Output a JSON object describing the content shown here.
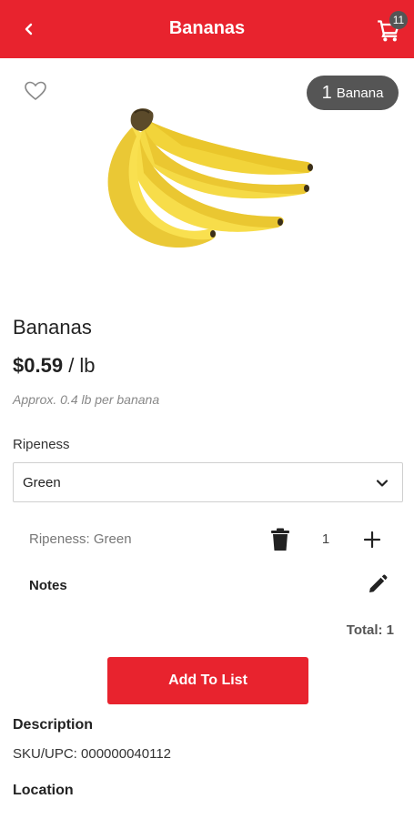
{
  "header": {
    "title": "Bananas",
    "back_icon": "chevron-left-icon",
    "cart_icon": "cart-icon",
    "cart_count": "11",
    "color": "#e8232e"
  },
  "product": {
    "favorite_icon": "heart-outline-icon",
    "unit_count": "1",
    "unit_word": "Banana",
    "image": "banana-bunch-image",
    "name": "Bananas",
    "price": "$0.59",
    "price_unit": "/ lb",
    "approx_note": "Approx. 0.4 lb per banana"
  },
  "ripeness": {
    "label": "Ripeness",
    "selected": "Green",
    "chevron_icon": "chevron-down-icon"
  },
  "line_item": {
    "label": "Ripeness: Green",
    "quantity": "1",
    "trash_icon": "trash-icon",
    "plus_icon": "plus-icon"
  },
  "notes": {
    "label": "Notes",
    "edit_icon": "pencil-icon"
  },
  "total_text": "Total: 1",
  "add_button_label": "Add To List",
  "description": {
    "heading": "Description",
    "sku": "SKU/UPC: 000000040112"
  },
  "location": {
    "heading": "Location"
  }
}
